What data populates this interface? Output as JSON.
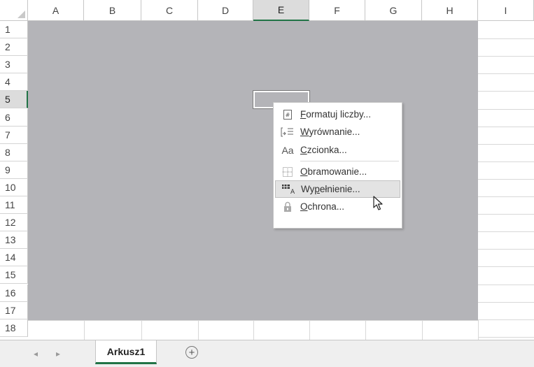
{
  "columns": [
    "A",
    "B",
    "C",
    "D",
    "E",
    "F",
    "G",
    "H",
    "I"
  ],
  "rows": [
    "1",
    "2",
    "3",
    "4",
    "5",
    "6",
    "7",
    "8",
    "9",
    "10",
    "11",
    "12",
    "13",
    "14",
    "15",
    "16",
    "17",
    "18"
  ],
  "active": {
    "column": "E",
    "row": "5"
  },
  "context_menu": {
    "items": [
      {
        "icon": "format-number-icon",
        "label": "Formatuj liczby...",
        "accel": "F"
      },
      {
        "icon": "alignment-icon",
        "label": "Wyrównanie...",
        "accel": "W"
      },
      {
        "icon": "font-icon",
        "glyph": "Aa",
        "label": "Czcionka...",
        "accel": "C"
      },
      {
        "icon": "border-icon",
        "label": "Obramowanie...",
        "accel": "O"
      },
      {
        "icon": "fill-icon",
        "label": "Wypełnienie...",
        "accel": "p",
        "hovered": true
      },
      {
        "icon": "lock-icon",
        "label": "Ochrona...",
        "accel": "O"
      }
    ]
  },
  "sheet_tabs": {
    "active": "Arkusz1",
    "add_symbol": "+",
    "prev_arrow": "◂",
    "next_arrow": "▸"
  },
  "colors": {
    "gray_area": "#b4b4b8",
    "accent": "#217346",
    "hover": "#e3e3e3"
  }
}
